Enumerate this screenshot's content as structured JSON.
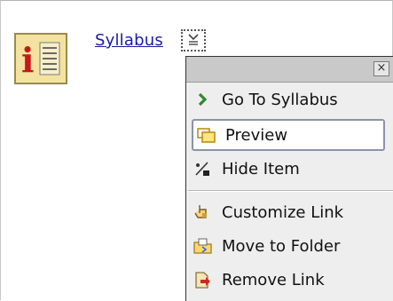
{
  "item": {
    "link_label": "Syllabus",
    "icon": "info-document-icon"
  },
  "menu": {
    "close_label": "×",
    "items": [
      {
        "label": "Go To Syllabus",
        "icon": "green-arrow-icon"
      },
      {
        "label": "Preview",
        "icon": "preview-window-icon",
        "selected": true
      },
      {
        "label": "Hide Item",
        "icon": "percent-hide-icon"
      },
      {
        "label": "Customize Link",
        "icon": "hand-pointer-icon"
      },
      {
        "label": "Move to Folder",
        "icon": "folder-move-icon"
      },
      {
        "label": "Remove Link",
        "icon": "remove-page-icon"
      }
    ]
  }
}
